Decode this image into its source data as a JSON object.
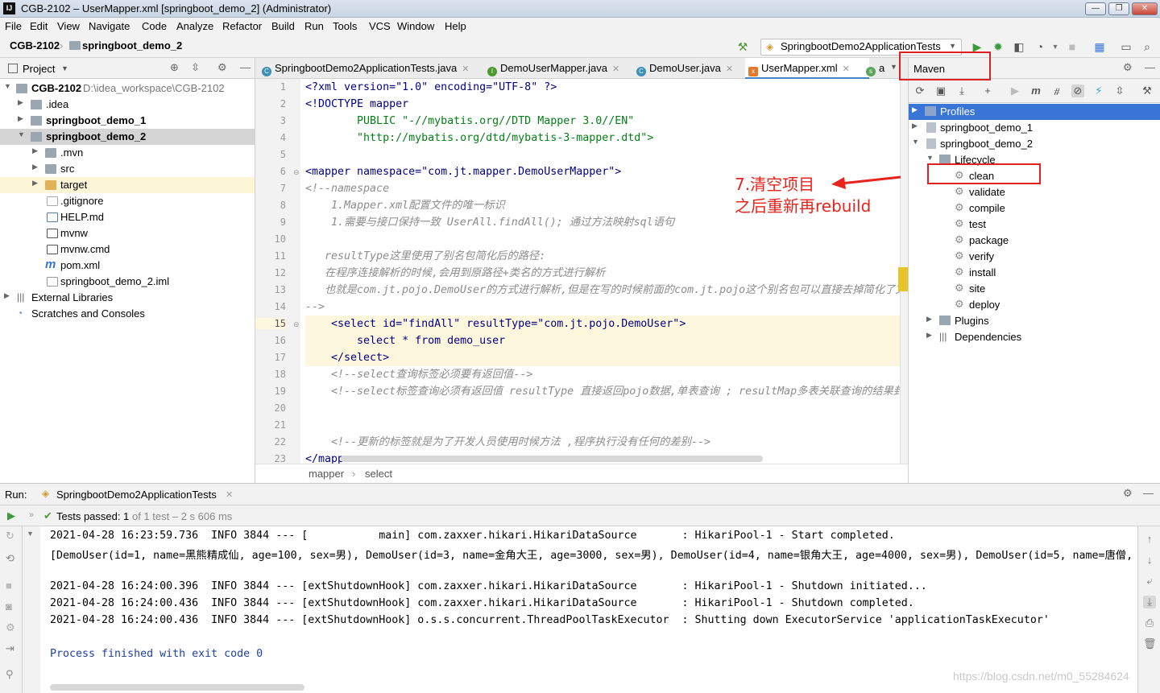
{
  "window": {
    "title": "CGB-2102 – UserMapper.xml [springboot_demo_2] (Administrator)",
    "app_icon": "IJ",
    "controls": [
      "—",
      "❐",
      "✕"
    ]
  },
  "menu": [
    "File",
    "Edit",
    "View",
    "Navigate",
    "Code",
    "Analyze",
    "Refactor",
    "Build",
    "Run",
    "Tools",
    "VCS",
    "Window",
    "Help"
  ],
  "navbar": {
    "crumbs": [
      "CGB-2102",
      "springboot_demo_2"
    ],
    "run_config": "SpringbootDemo2ApplicationTests"
  },
  "project": {
    "header": "Project",
    "tree": [
      {
        "label": "CGB-2102",
        "extra": "D:\\idea_workspace\\CGB-2102",
        "bold": true
      },
      {
        "label": ".idea"
      },
      {
        "label": "springboot_demo_1",
        "bold": true
      },
      {
        "label": "springboot_demo_2",
        "bold": true
      },
      {
        "label": ".mvn"
      },
      {
        "label": "src"
      },
      {
        "label": "target"
      },
      {
        "label": ".gitignore"
      },
      {
        "label": "HELP.md"
      },
      {
        "label": "mvnw"
      },
      {
        "label": "mvnw.cmd"
      },
      {
        "label": "pom.xml"
      },
      {
        "label": "springboot_demo_2.iml"
      },
      {
        "label": "External Libraries"
      },
      {
        "label": "Scratches and Consoles"
      }
    ]
  },
  "editor": {
    "tabs": [
      "SpringbootDemo2ApplicationTests.java",
      "DemoUserMapper.java",
      "DemoUser.java",
      "UserMapper.xml",
      "a"
    ],
    "line_numbers": [
      "1",
      "2",
      "3",
      "4",
      "5",
      "6",
      "7",
      "8",
      "9",
      "10",
      "11",
      "12",
      "13",
      "14",
      "15",
      "16",
      "17",
      "18",
      "19",
      "20",
      "21",
      "22",
      "23"
    ],
    "lines": [
      "<?xml version=\"1.0\" encoding=\"UTF-8\" ?>",
      "<!DOCTYPE mapper",
      "        PUBLIC \"-//mybatis.org//DTD Mapper 3.0//EN\"",
      "        \"http://mybatis.org/dtd/mybatis-3-mapper.dtd\">",
      "",
      "<mapper namespace=\"com.jt.mapper.DemoUserMapper\">",
      "<!--namespace",
      "    1.Mapper.xml配置文件的唯一标识",
      "    1.需要与接口保持一致 UserAll.findAll(); 通过方法映射sql语句",
      "",
      "   resultType这里使用了别名包简化后的路径:",
      "   在程序连接解析的时候,会用到原路径+类名的方式进行解析",
      "   也就是com.jt.pojo.DemoUser的方式进行解析,但是在写的时候前面的com.jt.pojo这个别名包可以直接去掉简化了文件",
      "-->",
      "    <select id=\"findAll\" resultType=\"com.jt.pojo.DemoUser\">",
      "        select * from demo_user",
      "    </select>",
      "    <!--select查询标签必须要有返回值-->",
      "    <!--select标签查询必须有返回值 resultType 直接返回pojo数据,单表查询 ; resultMap多表关联查询的结果封装",
      "",
      "",
      "    <!--更新的标签就是为了开发人员使用时候方法 ,程序执行没有任何的差别-->",
      "</mapper>"
    ],
    "breadcrumb": [
      "mapper",
      "select"
    ]
  },
  "maven": {
    "header": "Maven",
    "tree": [
      {
        "label": "Profiles"
      },
      {
        "label": "springboot_demo_1"
      },
      {
        "label": "springboot_demo_2"
      },
      {
        "label": "Lifecycle"
      },
      {
        "label": "clean"
      },
      {
        "label": "validate"
      },
      {
        "label": "compile"
      },
      {
        "label": "test"
      },
      {
        "label": "package"
      },
      {
        "label": "verify"
      },
      {
        "label": "install"
      },
      {
        "label": "site"
      },
      {
        "label": "deploy"
      },
      {
        "label": "Plugins"
      },
      {
        "label": "Dependencies"
      }
    ]
  },
  "annotation": {
    "line1": "7.清空项目",
    "line2": "之后重新再rebuild"
  },
  "run": {
    "label": "Run:",
    "tab": "SpringbootDemo2ApplicationTests",
    "status_prefix": "Tests passed:",
    "status_count": "1",
    "status_suffix": "of 1 test – 2 s 606 ms",
    "console": [
      "2021-04-28 16:23:59.736  INFO 3844 --- [           main] com.zaxxer.hikari.HikariDataSource       : HikariPool-1 - Start completed.",
      "[DemoUser(id=1, name=黑熊精成仙, age=100, sex=男), DemoUser(id=3, name=金角大王, age=3000, sex=男), DemoUser(id=4, name=银角大王, age=4000, sex=男), DemoUser(id=5, name=唐僧, a",
      "",
      "2021-04-28 16:24:00.396  INFO 3844 --- [extShutdownHook] com.zaxxer.hikari.HikariDataSource       : HikariPool-1 - Shutdown initiated...",
      "2021-04-28 16:24:00.436  INFO 3844 --- [extShutdownHook] com.zaxxer.hikari.HikariDataSource       : HikariPool-1 - Shutdown completed.",
      "2021-04-28 16:24:00.436  INFO 3844 --- [extShutdownHook] o.s.s.concurrent.ThreadPoolTaskExecutor  : Shutting down ExecutorService 'applicationTaskExecutor'",
      "",
      "Process finished with exit code 0"
    ]
  },
  "watermark": "https://blog.csdn.net/m0_55284624",
  "colors": {
    "accent": "#3875d7",
    "annotation": "#e8231d",
    "highlight": "#fcf7dd",
    "pass": "#4e9a30"
  }
}
